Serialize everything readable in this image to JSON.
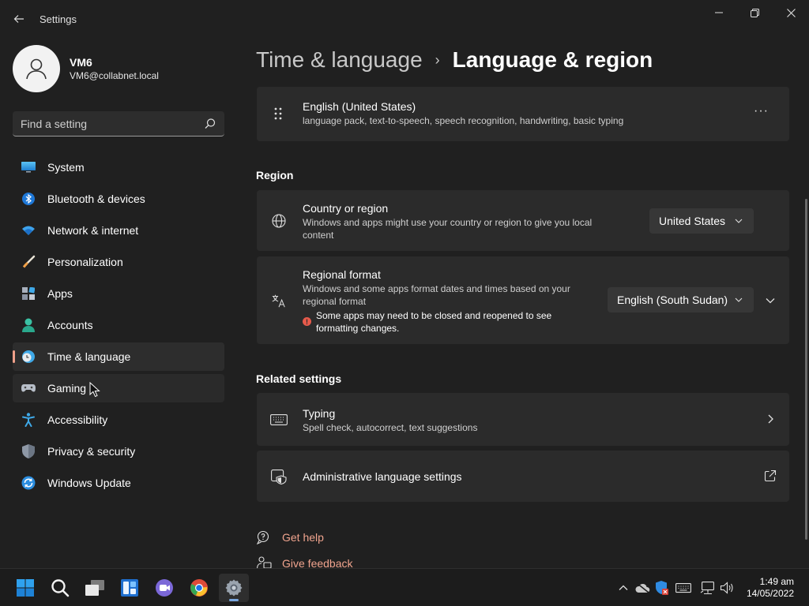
{
  "window": {
    "title": "Settings",
    "controls": [
      "minimize",
      "restore",
      "close"
    ]
  },
  "profile": {
    "name": "VM6",
    "email": "VM6@collabnet.local"
  },
  "search": {
    "placeholder": "Find a setting"
  },
  "sidebar": {
    "items": [
      {
        "label": "System",
        "icon": "system-icon"
      },
      {
        "label": "Bluetooth & devices",
        "icon": "bluetooth-icon"
      },
      {
        "label": "Network & internet",
        "icon": "wifi-icon"
      },
      {
        "label": "Personalization",
        "icon": "brush-icon"
      },
      {
        "label": "Apps",
        "icon": "apps-icon"
      },
      {
        "label": "Accounts",
        "icon": "person-icon"
      },
      {
        "label": "Time & language",
        "icon": "globe-clock-icon",
        "selected": true
      },
      {
        "label": "Gaming",
        "icon": "gamepad-icon"
      },
      {
        "label": "Accessibility",
        "icon": "accessibility-icon"
      },
      {
        "label": "Privacy & security",
        "icon": "shield-icon"
      },
      {
        "label": "Windows Update",
        "icon": "update-icon"
      }
    ]
  },
  "breadcrumb": {
    "parent": "Time & language",
    "separator": "›",
    "current": "Language & region"
  },
  "language_card": {
    "title": "English (United States)",
    "subtitle": "language pack, text-to-speech, speech recognition, handwriting, basic typing",
    "more": "···"
  },
  "region": {
    "heading": "Region",
    "country": {
      "title": "Country or region",
      "desc_line1": "Windows and apps might use your country or region to give you local",
      "desc_line2": "content",
      "value": "United States"
    },
    "format": {
      "title": "Regional format",
      "desc_line1": "Windows and some apps format dates and times based on your",
      "desc_line2": "regional format",
      "warning_line1": "Some apps may need to be closed and reopened to see",
      "warning_line2": "formatting changes.",
      "value": "English (South Sudan)"
    }
  },
  "related": {
    "heading": "Related settings",
    "typing": {
      "title": "Typing",
      "subtitle": "Spell check, autocorrect, text suggestions"
    },
    "admin": {
      "title": "Administrative language settings"
    }
  },
  "links": {
    "help": "Get help",
    "feedback": "Give feedback"
  },
  "taskbar": {
    "apps": [
      "start-icon",
      "search-icon",
      "task-view-icon",
      "widgets-icon",
      "chat-icon",
      "chrome-icon",
      "settings-icon"
    ],
    "time": "1:49 am",
    "date": "14/05/2022"
  },
  "colors": {
    "accent": "#f0a08a",
    "background": "#202020",
    "card": "#2b2b2b",
    "warning": "#e65a4b"
  }
}
